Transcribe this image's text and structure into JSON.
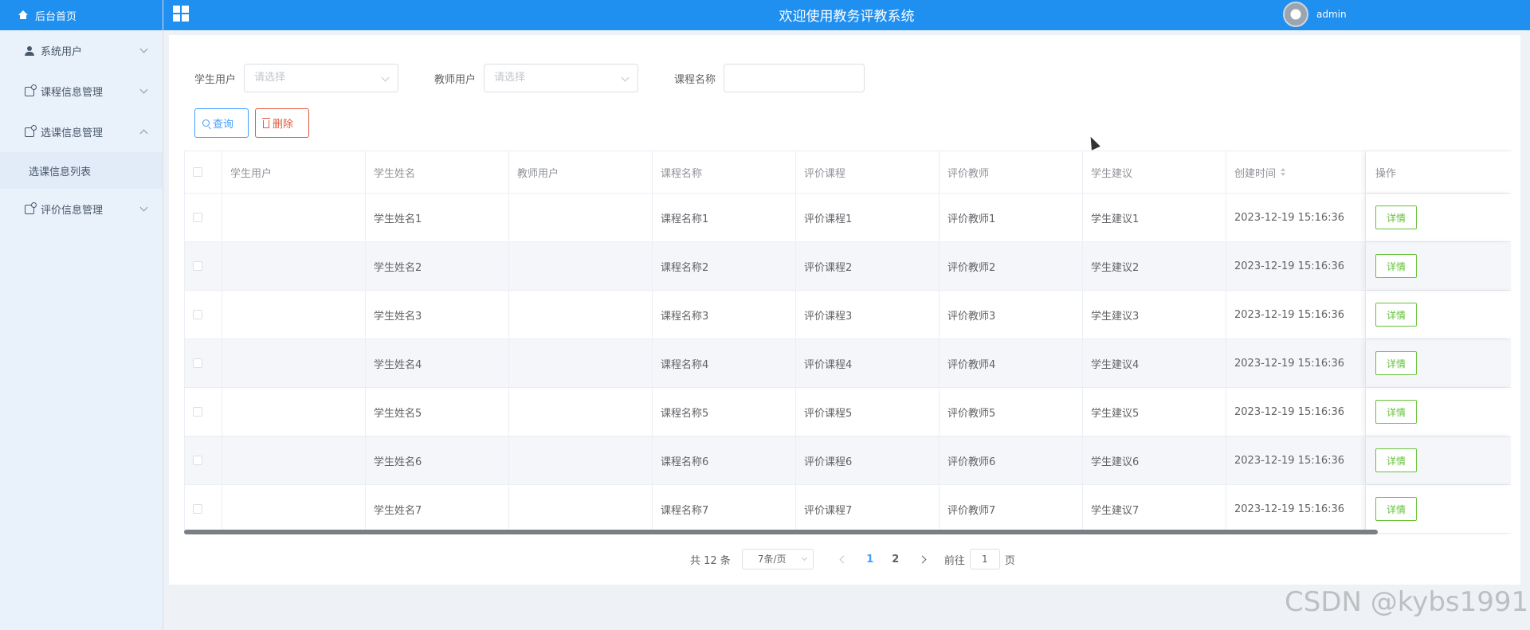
{
  "sidebar": {
    "home_label": "后台首页",
    "items": [
      {
        "label": "系统用户",
        "icon": "user-icon",
        "expanded": false
      },
      {
        "label": "课程信息管理",
        "icon": "box-icon",
        "expanded": false
      },
      {
        "label": "选课信息管理",
        "icon": "box-icon",
        "expanded": true
      },
      {
        "label": "评价信息管理",
        "icon": "box-icon",
        "expanded": false
      }
    ],
    "submenu_label": "选课信息列表"
  },
  "header": {
    "title": "欢迎使用教务评教系统",
    "username": "admin"
  },
  "filters": {
    "student_label": "学生用户",
    "student_placeholder": "请选择",
    "teacher_label": "教师用户",
    "teacher_placeholder": "请选择",
    "course_label": "课程名称",
    "course_value": ""
  },
  "buttons": {
    "search": "查询",
    "delete": "删除"
  },
  "table": {
    "columns": [
      "学生用户",
      "学生姓名",
      "教师用户",
      "课程名称",
      "评价课程",
      "评价教师",
      "学生建议",
      "创建时间",
      "操作"
    ],
    "rows": [
      {
        "student_user": "",
        "student_name": "学生姓名1",
        "teacher_user": "",
        "course_name": "课程名称1",
        "eval_course": "评价课程1",
        "eval_teacher": "评价教师1",
        "suggestion": "学生建议1",
        "created": "2023-12-19 15:16:36",
        "action": "详情"
      },
      {
        "student_user": "",
        "student_name": "学生姓名2",
        "teacher_user": "",
        "course_name": "课程名称2",
        "eval_course": "评价课程2",
        "eval_teacher": "评价教师2",
        "suggestion": "学生建议2",
        "created": "2023-12-19 15:16:36",
        "action": "详情"
      },
      {
        "student_user": "",
        "student_name": "学生姓名3",
        "teacher_user": "",
        "course_name": "课程名称3",
        "eval_course": "评价课程3",
        "eval_teacher": "评价教师3",
        "suggestion": "学生建议3",
        "created": "2023-12-19 15:16:36",
        "action": "详情"
      },
      {
        "student_user": "",
        "student_name": "学生姓名4",
        "teacher_user": "",
        "course_name": "课程名称4",
        "eval_course": "评价课程4",
        "eval_teacher": "评价教师4",
        "suggestion": "学生建议4",
        "created": "2023-12-19 15:16:36",
        "action": "详情"
      },
      {
        "student_user": "",
        "student_name": "学生姓名5",
        "teacher_user": "",
        "course_name": "课程名称5",
        "eval_course": "评价课程5",
        "eval_teacher": "评价教师5",
        "suggestion": "学生建议5",
        "created": "2023-12-19 15:16:36",
        "action": "详情"
      },
      {
        "student_user": "",
        "student_name": "学生姓名6",
        "teacher_user": "",
        "course_name": "课程名称6",
        "eval_course": "评价课程6",
        "eval_teacher": "评价教师6",
        "suggestion": "学生建议6",
        "created": "2023-12-19 15:16:36",
        "action": "详情"
      },
      {
        "student_user": "",
        "student_name": "学生姓名7",
        "teacher_user": "",
        "course_name": "课程名称7",
        "eval_course": "评价课程7",
        "eval_teacher": "评价教师7",
        "suggestion": "学生建议7",
        "created": "2023-12-19 15:16:36",
        "action": "详情"
      }
    ]
  },
  "pagination": {
    "total": "共 12 条",
    "page_size": "7条/页",
    "pages": [
      "1",
      "2"
    ],
    "current_page": "1",
    "goto_label": "前往",
    "goto_value": "1",
    "page_suffix": "页"
  },
  "watermark": "CSDN @kybs1991",
  "colors": {
    "primary": "#1f8ff0",
    "search_button": "#409eff",
    "delete_button": "#e05a3f",
    "detail_button": "#67c23a"
  }
}
